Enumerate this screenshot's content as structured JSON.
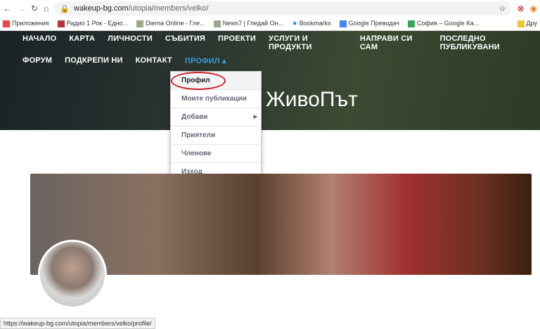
{
  "browser": {
    "url_host": "wakeup-bg.com",
    "url_path": "/utopia/members/velko/",
    "status_url": "https://wakeup-bg.com/utopia/members/velko/profile/",
    "bookmarks": [
      "Приложения",
      "Радио 1 Рок - Едно...",
      "Diema Online - Гле...",
      "News7 | Гледай Он...",
      "Bookmarks",
      "Google Преводач",
      "София – Google Ка...",
      "Дру"
    ]
  },
  "nav": {
    "row1": [
      "НАЧАЛО",
      "КАРТА",
      "ЛИЧНОСТИ",
      "СЪБИТИЯ",
      "ПРОЕКТИ",
      "УСЛУГИ И ПРОДУКТИ",
      "НАПРАВИ СИ САМ",
      "ПОСЛЕДНО ПУБЛИКУВАНИ"
    ],
    "row2": [
      "ФОРУМ",
      "ПОДКРЕПИ НИ",
      "КОНТАКТ"
    ],
    "active": "ПРОФИЛ ▴"
  },
  "hero_title": "от ЖивоПът",
  "dropdown": [
    "Профил",
    "Моите публикации",
    "Добави",
    "Приятели",
    "Членове",
    "Изход"
  ],
  "colors": {
    "active_nav": "#3a9bd6",
    "highlight_circle": "#d0202a"
  }
}
